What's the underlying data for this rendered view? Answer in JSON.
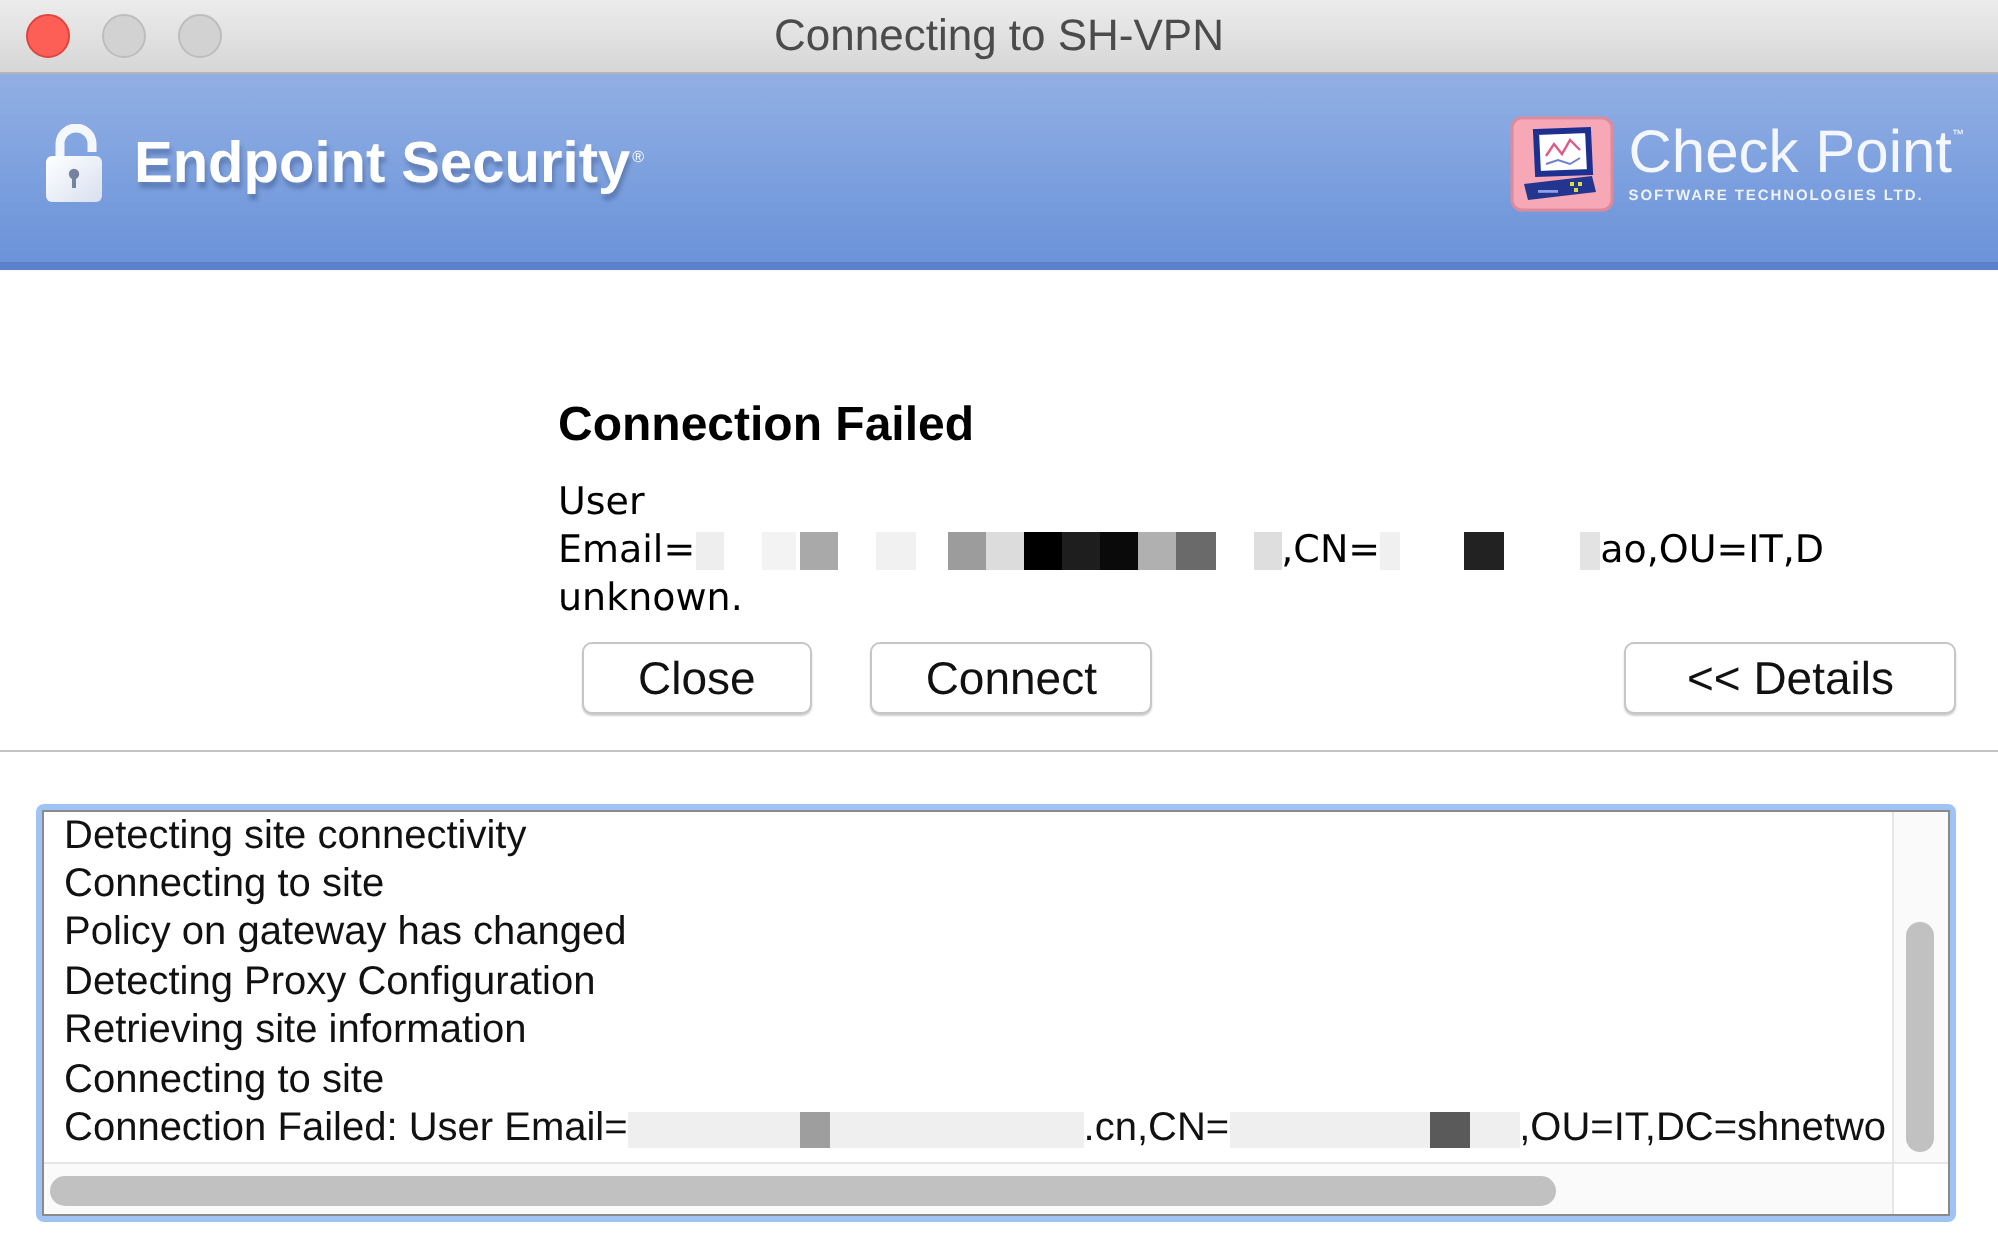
{
  "window": {
    "title": "Connecting to SH-VPN",
    "buttons": [
      {
        "kind": "close",
        "disabled": false
      },
      {
        "kind": "minimize",
        "disabled": true
      },
      {
        "kind": "zoom",
        "disabled": true
      }
    ]
  },
  "header": {
    "product": "Endpoint Security",
    "product_mark": "®",
    "vendor": "Check Point",
    "vendor_mark": "™",
    "vendor_tagline": "SOFTWARE TECHNOLOGIES LTD."
  },
  "status": {
    "title": "Connection Failed",
    "message_lines": [
      {
        "segments": [
          {
            "kind": "text",
            "text": "User"
          }
        ]
      },
      {
        "segments": [
          {
            "kind": "text",
            "text": "Email="
          },
          {
            "kind": "redacted"
          },
          {
            "kind": "text",
            "text": ",CN="
          },
          {
            "kind": "redacted"
          },
          {
            "kind": "text",
            "text": "ao,OU=IT,D"
          }
        ]
      },
      {
        "segments": [
          {
            "kind": "text",
            "text": "unknown."
          }
        ]
      }
    ],
    "buttons": [
      "Close",
      "Connect"
    ],
    "details_button": "<< Details"
  },
  "log": {
    "lines": [
      {
        "segments": [
          {
            "kind": "text",
            "text": "Detecting site connectivity"
          }
        ]
      },
      {
        "segments": [
          {
            "kind": "text",
            "text": "Connecting to site"
          }
        ]
      },
      {
        "segments": [
          {
            "kind": "text",
            "text": "Policy on gateway has changed"
          }
        ]
      },
      {
        "segments": [
          {
            "kind": "text",
            "text": "Detecting Proxy Configuration"
          }
        ]
      },
      {
        "segments": [
          {
            "kind": "text",
            "text": "Retrieving site information"
          }
        ]
      },
      {
        "segments": [
          {
            "kind": "text",
            "text": "Connecting to site"
          }
        ]
      },
      {
        "segments": [
          {
            "kind": "text",
            "text": "Connection Failed: User Email="
          },
          {
            "kind": "redacted"
          },
          {
            "kind": "text",
            "text": ".cn,CN="
          },
          {
            "kind": "redacted"
          },
          {
            "kind": "text",
            "text": ",OU=IT,DC=shnetwo"
          }
        ]
      }
    ]
  }
}
